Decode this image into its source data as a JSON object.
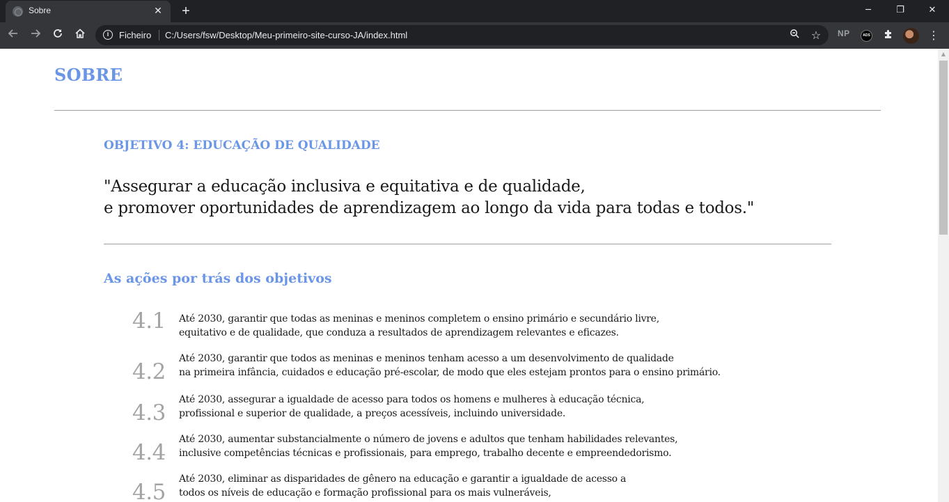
{
  "browser": {
    "tab_title": "Sobre",
    "new_tab_symbol": "+",
    "close_tab_symbol": "✕",
    "scheme_label": "Ficheiro",
    "url": "C:/Users/fsw/Desktop/Meu-primeiro-site-curso-JA/index.html",
    "extensions": {
      "np_label": "NP",
      "ads_label": "ADS"
    },
    "window_controls": {
      "minimize": "─",
      "maximize": "❐",
      "close": "✕"
    },
    "icons": [
      "back-arrow-icon",
      "forward-arrow-icon",
      "reload-icon",
      "home-icon",
      "info-icon",
      "zoom-icon",
      "star-icon",
      "puzzle-icon",
      "menu-dots-icon"
    ]
  },
  "page": {
    "title": "SOBRE",
    "goal_title": "OBJETIVO 4: EDUCAÇÃO DE QUALIDADE",
    "quote_line_1": "\"Assegurar a educação inclusiva e equitativa e de qualidade,",
    "quote_line_2": "e promover oportunidades de aprendizagem ao longo da vida para todas e todos.\"",
    "section_title": "As ações por trás dos objetivos",
    "goals": [
      {
        "number": "4.1",
        "line_1": "Até 2030, garantir que todas as meninas e meninos completem o ensino primário e secundário livre,",
        "line_2": "equitativo e de qualidade, que conduza a resultados de aprendizagem relevantes e eficazes."
      },
      {
        "number": "4.2",
        "line_1": "Até 2030, garantir que todos as meninas e meninos tenham acesso a um desenvolvimento de qualidade",
        "line_2": "na primeira infância, cuidados e educação pré-escolar, de modo que eles estejam prontos para o ensino primário."
      },
      {
        "number": "4.3",
        "line_1": "Até 2030, assegurar a igualdade de acesso para todos os homens e mulheres à educação técnica,",
        "line_2": "profissional e superior de qualidade, a preços acessíveis, incluindo universidade."
      },
      {
        "number": "4.4",
        "line_1": "Até 2030, aumentar substancialmente o número de jovens e adultos que tenham habilidades relevantes,",
        "line_2": "inclusive competências técnicas e profissionais, para emprego, trabalho decente e empreendedorismo."
      },
      {
        "number": "4.5",
        "line_1": "Até 2030, eliminar as disparidades de gênero na educação e garantir a igualdade de acesso a",
        "line_2": "todos os níveis de educação e formação profissional para os mais vulneráveis,"
      }
    ]
  },
  "colors": {
    "heading_blue": "#6b96e6",
    "number_gray": "#a3a3a3",
    "chrome_dark": "#202124",
    "chrome_toolbar": "#35363a"
  }
}
